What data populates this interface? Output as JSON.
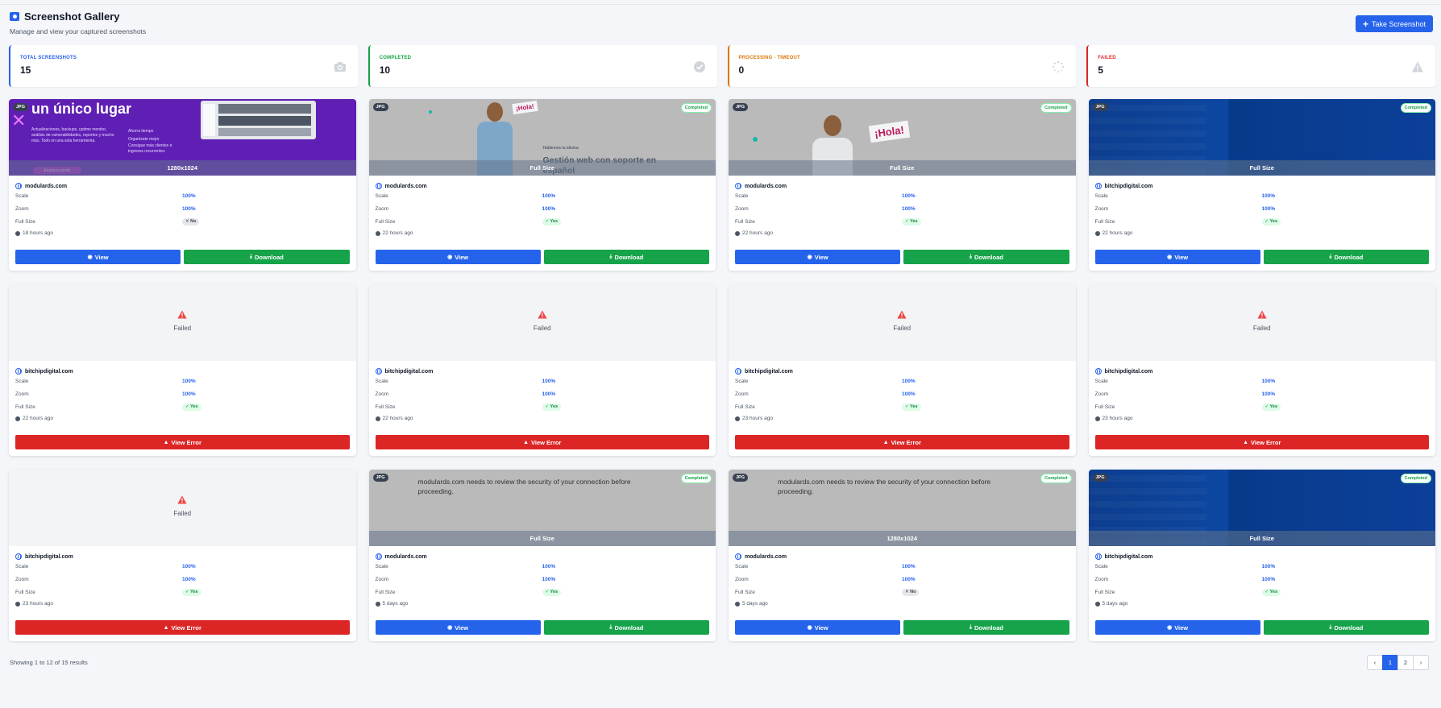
{
  "header": {
    "title": "Screenshot Gallery",
    "subtitle": "Manage and view your captured screenshots",
    "take_button": "Take Screenshot"
  },
  "stats": [
    {
      "label": "TOTAL SCREENSHOTS",
      "value": "15",
      "color": "#2563eb",
      "icon": "camera-icon"
    },
    {
      "label": "COMPLETED",
      "value": "10",
      "color": "#16a34a",
      "icon": "check-circle-icon"
    },
    {
      "label": "PROCESSING - TIMEOUT",
      "value": "0",
      "color": "#d97706",
      "icon": "spinner-icon"
    },
    {
      "label": "FAILED",
      "value": "5",
      "color": "#dc2626",
      "icon": "warning-icon"
    }
  ],
  "labels": {
    "scale": "Scale",
    "zoom": "Zoom",
    "full_size": "Full Size",
    "view": "View",
    "download": "Download",
    "view_error": "View Error",
    "failed": "Failed",
    "jpg": "JPG",
    "completed": "Completed",
    "yes": "Yes",
    "no": "No"
  },
  "thumb_texts": {
    "purple_heading": "un único lugar",
    "purple_body": "Actualizaciones, backups, uptime monitor, análisis de vulnerabilidades, reportes y mucho más. Todo en una sola herramienta.",
    "purple_check_1": "Ahorra tiempo",
    "purple_check_2": "Organízate mejor",
    "purple_check_3": "Consigue más clientes e ingresos recurrentes",
    "purple_cta": "Empieza gratis",
    "hola": "¡Hola!",
    "hablemos": "Hablemos tu idioma",
    "gestion": "Gestión web con soporte en español",
    "security": "modulards.com needs to review the security of your connection before proceeding."
  },
  "cards": [
    {
      "thumb": "purple",
      "overlay": "1280x1024",
      "jpg": true,
      "completed": false,
      "host": "modulards.com",
      "scale": "100%",
      "zoom": "100%",
      "full_size": "No",
      "time": "18 hours ago",
      "status": "ok"
    },
    {
      "thumb": "hola1",
      "overlay": "Full Size",
      "jpg": true,
      "completed": true,
      "host": "modulards.com",
      "scale": "100%",
      "zoom": "100%",
      "full_size": "Yes",
      "time": "22 hours ago",
      "status": "ok"
    },
    {
      "thumb": "hola2",
      "overlay": "Full Size",
      "jpg": true,
      "completed": true,
      "host": "modulards.com",
      "scale": "100%",
      "zoom": "100%",
      "full_size": "Yes",
      "time": "22 hours ago",
      "status": "ok"
    },
    {
      "thumb": "blue",
      "overlay": "Full Size",
      "jpg": true,
      "completed": true,
      "host": "bitchipdigital.com",
      "scale": "100%",
      "zoom": "100%",
      "full_size": "Yes",
      "time": "22 hours ago",
      "status": "ok"
    },
    {
      "thumb": "failed",
      "host": "bitchipdigital.com",
      "scale": "100%",
      "zoom": "100%",
      "full_size": "Yes",
      "time": "22 hours ago",
      "status": "failed"
    },
    {
      "thumb": "failed",
      "host": "bitchipdigital.com",
      "scale": "100%",
      "zoom": "100%",
      "full_size": "Yes",
      "time": "22 hours ago",
      "status": "failed"
    },
    {
      "thumb": "failed",
      "host": "bitchipdigital.com",
      "scale": "100%",
      "zoom": "100%",
      "full_size": "Yes",
      "time": "23 hours ago",
      "status": "failed"
    },
    {
      "thumb": "failed",
      "host": "bitchipdigital.com",
      "scale": "100%",
      "zoom": "100%",
      "full_size": "Yes",
      "time": "23 hours ago",
      "status": "failed"
    },
    {
      "thumb": "failed",
      "host": "bitchipdigital.com",
      "scale": "100%",
      "zoom": "100%",
      "full_size": "Yes",
      "time": "23 hours ago",
      "status": "failed"
    },
    {
      "thumb": "security",
      "overlay": "Full Size",
      "jpg": true,
      "completed": true,
      "host": "modulards.com",
      "scale": "100%",
      "zoom": "100%",
      "full_size": "Yes",
      "time": "5 days ago",
      "status": "ok"
    },
    {
      "thumb": "security",
      "overlay": "1280x1024",
      "jpg": true,
      "completed": true,
      "host": "modulards.com",
      "scale": "100%",
      "zoom": "100%",
      "full_size": "No",
      "time": "5 days ago",
      "status": "ok"
    },
    {
      "thumb": "blue",
      "overlay": "Full Size",
      "jpg": true,
      "completed": true,
      "host": "bitchipdigital.com",
      "scale": "100%",
      "zoom": "100%",
      "full_size": "Yes",
      "time": "5 days ago",
      "status": "ok"
    }
  ],
  "footer": {
    "showing": "Showing 1 to 12 of 15 results",
    "pages": [
      "1",
      "2"
    ],
    "current_page": "1",
    "prev": "‹",
    "next": "›"
  }
}
